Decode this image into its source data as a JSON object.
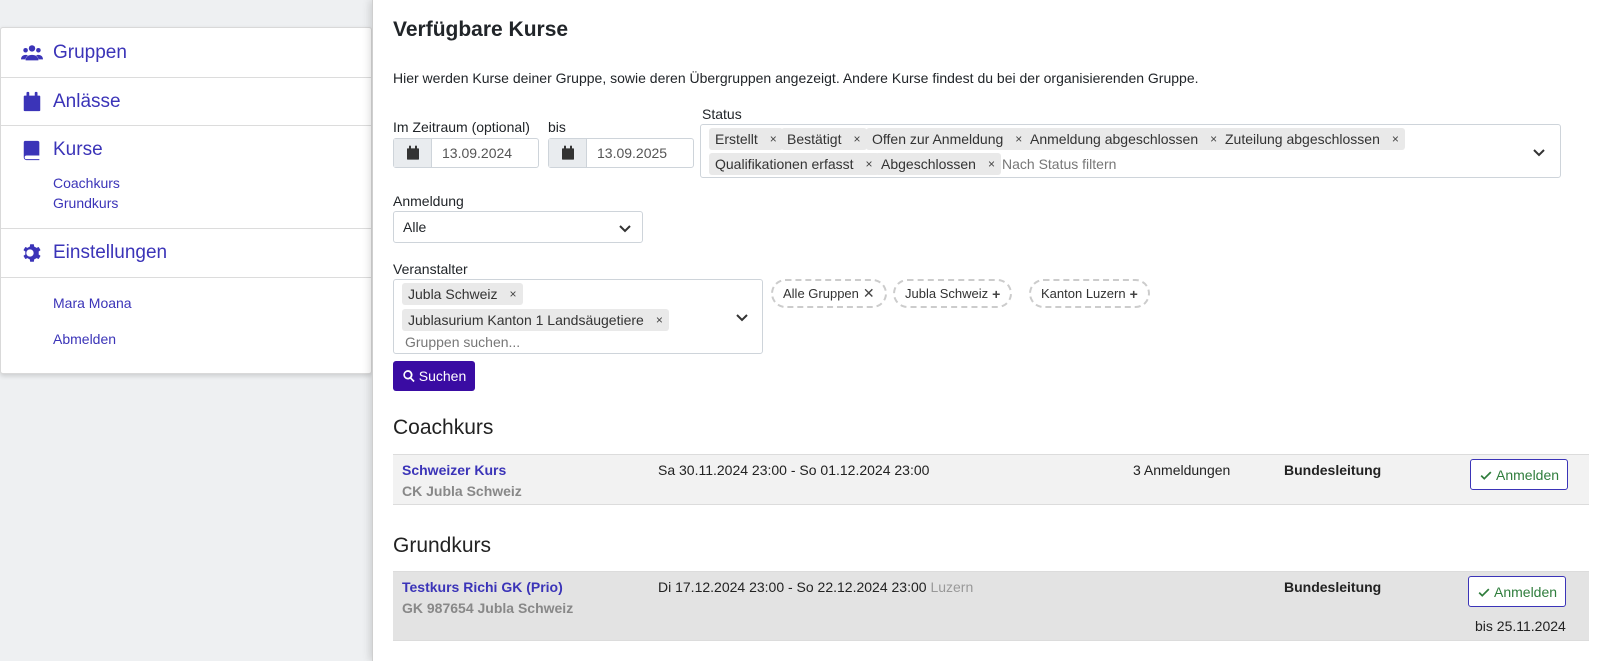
{
  "sidebar": {
    "items": [
      {
        "label": "Gruppen",
        "icon": "users-icon"
      },
      {
        "label": "Anlässe",
        "icon": "calendar-icon"
      },
      {
        "label": "Kurse",
        "icon": "book-icon"
      },
      {
        "label": "Einstellungen",
        "icon": "gear-icon"
      }
    ],
    "kurse_sub": [
      "Coachkurs",
      "Grundkurs"
    ],
    "user_links": [
      "Mara Moana",
      "Abmelden"
    ]
  },
  "main": {
    "title": "Verfügbare Kurse",
    "intro": "Hier werden Kurse deiner Gruppe, sowie deren Übergruppen angezeigt. Andere Kurse findest du bei der organisierenden Gruppe.",
    "filters": {
      "period_label": "Im Zeitraum (optional)",
      "from": "13.09.2024",
      "to_label": "bis",
      "to": "13.09.2025",
      "status_label": "Status",
      "status_chips": [
        "Erstellt",
        "Bestätigt",
        "Offen zur Anmeldung",
        "Anmeldung abgeschlossen",
        "Zuteilung abgeschlossen",
        "Qualifikationen erfasst",
        "Abgeschlossen"
      ],
      "status_placeholder": "Nach Status filtern",
      "anmeldung_label": "Anmeldung",
      "anmeldung_value": "Alle",
      "veranstalter_label": "Veranstalter",
      "veranstalter_chips": [
        "Jubla Schweiz",
        "Jublasurium Kanton 1 Landsäugetiere"
      ],
      "veranstalter_placeholder": "Gruppen suchen...",
      "quick_groups": [
        {
          "label": "Alle Gruppen",
          "symbol": "✕"
        },
        {
          "label": "Jubla Schweiz",
          "symbol": "+"
        },
        {
          "label": "Kanton Luzern",
          "symbol": "+"
        }
      ],
      "search_label": "Suchen"
    },
    "sections": [
      {
        "heading": "Coachkurs",
        "course": {
          "name": "Schweizer Kurs",
          "sub": "CK Jubla Schweiz",
          "dates": "Sa 30.11.2024 23:00 - So 01.12.2024 23:00",
          "location": "",
          "registrations": "3 Anmeldungen",
          "organizer": "Bundesleitung",
          "button": "Anmelden",
          "deadline": ""
        }
      },
      {
        "heading": "Grundkurs",
        "course": {
          "name": "Testkurs Richi GK (Prio)",
          "sub": "GK 987654 Jubla Schweiz",
          "dates": "Di 17.12.2024 23:00 - So 22.12.2024 23:00",
          "location": "Luzern",
          "registrations": "",
          "organizer": "Bundesleitung",
          "button": "Anmelden",
          "deadline": "bis 25.11.2024"
        }
      }
    ]
  },
  "colors": {
    "link": "#3b34b8",
    "primary_button": "#3a0ca3",
    "success": "#2f7d3c"
  }
}
